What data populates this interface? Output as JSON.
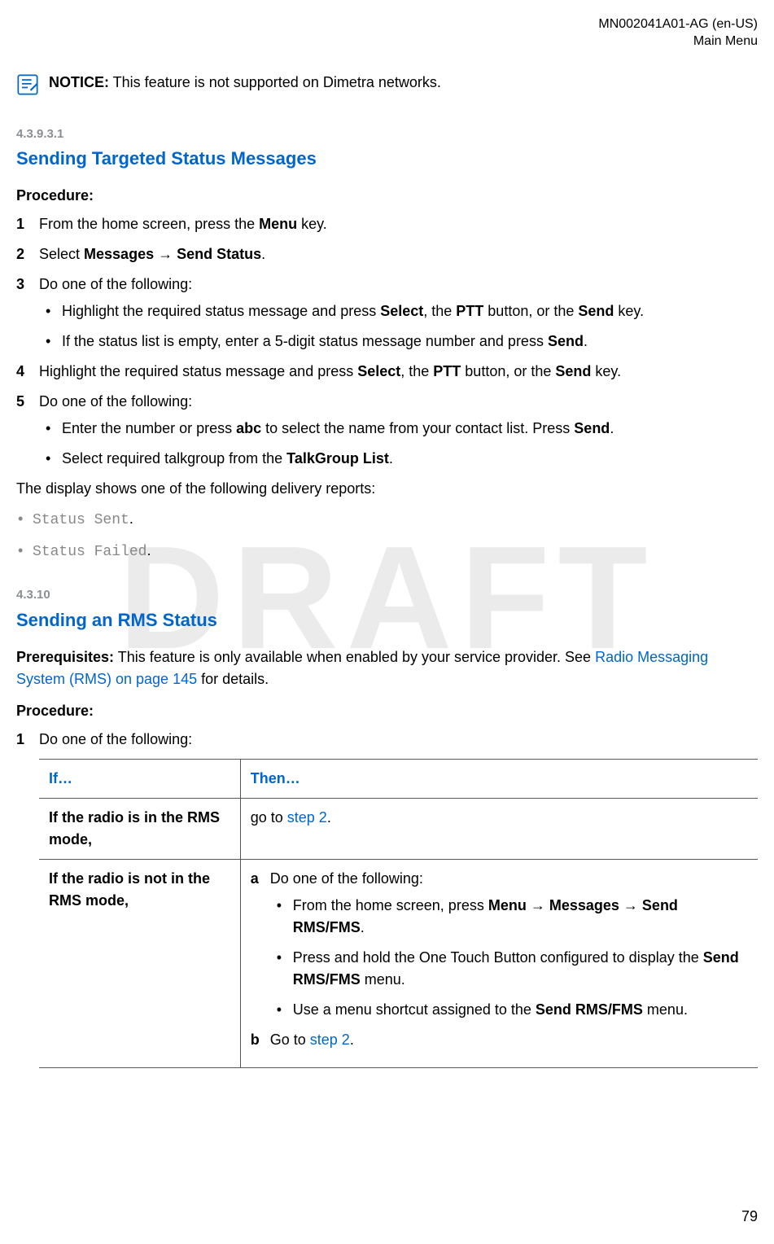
{
  "header": {
    "doc_id": "MN002041A01-AG (en-US)",
    "section": "Main Menu"
  },
  "watermark": "DRAFT",
  "notice": {
    "label": "NOTICE:",
    "text": " This feature is not supported on Dimetra networks."
  },
  "sec1": {
    "num": "4.3.9.3.1",
    "title": "Sending Targeted Status Messages",
    "procedure_label": "Procedure:",
    "steps": {
      "s1": {
        "num": "1",
        "a": "From the home screen, press the ",
        "b": "Menu",
        "c": " key."
      },
      "s2": {
        "num": "2",
        "a": "Select ",
        "b": "Messages",
        "arrow": " → ",
        "c": "Send Status",
        "d": "."
      },
      "s3": {
        "num": "3",
        "intro": "Do one of the following:",
        "b1": {
          "a": "Highlight the required status message and press ",
          "b": "Select",
          "c": ", the ",
          "d": "PTT",
          "e": " button, or the ",
          "f": "Send",
          "g": " key."
        },
        "b2": {
          "a": "If the status list is empty, enter a 5-digit status message number and press ",
          "b": "Send",
          "c": "."
        }
      },
      "s4": {
        "num": "4",
        "a": "Highlight the required status message and press ",
        "b": "Select",
        "c": ", the ",
        "d": "PTT",
        "e": " button, or the ",
        "f": "Send",
        "g": " key."
      },
      "s5": {
        "num": "5",
        "intro": "Do one of the following:",
        "b1": {
          "a": "Enter the number or press ",
          "b": "abc",
          "c": " to select the name from your contact list. Press ",
          "d": "Send",
          "e": "."
        },
        "b2": {
          "a": "Select required talkgroup from the ",
          "b": "TalkGroup List",
          "c": "."
        }
      }
    },
    "after": "The display shows one of the following delivery reports:",
    "reports": {
      "r1": "Status Sent",
      "r2": "Status Failed"
    }
  },
  "sec2": {
    "num": "4.3.10",
    "title": "Sending an RMS Status",
    "prereq_label": "Prerequisites:",
    "prereq_text": " This feature is only available when enabled by your service provider. See ",
    "prereq_link": "Radio Messaging System (RMS) on page 145",
    "prereq_after": " for details.",
    "procedure_label": "Procedure:",
    "step1": {
      "num": "1",
      "text": "Do one of the following:"
    },
    "table": {
      "h_if": "If…",
      "h_then": "Then…",
      "row1": {
        "if": "If the radio is in the RMS mode,",
        "then_a": "go to ",
        "then_link": "step 2",
        "then_c": "."
      },
      "row2": {
        "if": "If the radio is not in the RMS mode,",
        "a": {
          "letter": "a",
          "text": "Do one of the following:"
        },
        "bullets": {
          "b1": {
            "a": "From the home screen, press ",
            "b": "Menu",
            "arr1": " → ",
            "c": "Messages",
            "arr2": " → ",
            "d": "Send RMS/FMS",
            "e": "."
          },
          "b2": {
            "a": "Press and hold the One Touch Button configured to display the ",
            "b": "Send RMS/FMS",
            "c": " menu."
          },
          "b3": {
            "a": "Use a menu shortcut assigned to the ",
            "b": "Send RMS/FMS",
            "c": " menu."
          }
        },
        "b": {
          "letter": "b",
          "a": "Go to ",
          "link": "step 2",
          "c": "."
        }
      }
    }
  },
  "page_num": "79"
}
